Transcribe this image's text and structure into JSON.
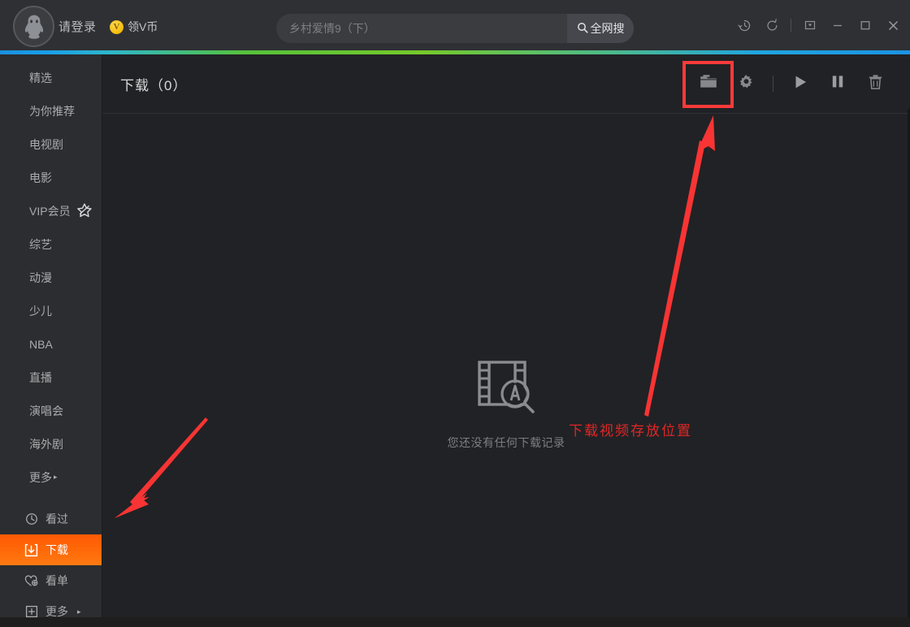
{
  "app": {
    "accent_orange": "#ff6a09",
    "annotation_red": "#e22626",
    "background": "#212225"
  },
  "header": {
    "avatar_icon": "qq-penguin-icon",
    "login_label": "请登录",
    "vcoin_badge": "V",
    "vcoin_label": "领V币",
    "search": {
      "placeholder": "乡村爱情9（下）",
      "value": "",
      "button_label": "全网搜",
      "button_icon": "search-icon"
    },
    "window_tools": [
      {
        "name": "history-icon",
        "glyph": "history"
      },
      {
        "name": "refresh-icon",
        "glyph": "refresh"
      },
      {
        "name": "divider",
        "glyph": "sep"
      },
      {
        "name": "restore-down-icon",
        "glyph": "box-arrow"
      },
      {
        "name": "minimize-icon",
        "glyph": "minimize"
      },
      {
        "name": "maximize-icon",
        "glyph": "maximize"
      },
      {
        "name": "close-icon",
        "glyph": "close"
      }
    ]
  },
  "sidebar": {
    "channels": [
      {
        "label": "精选",
        "badge": null
      },
      {
        "label": "为你推荐",
        "badge": null
      },
      {
        "label": "电视剧",
        "badge": null
      },
      {
        "label": "电影",
        "badge": null
      },
      {
        "label": "VIP会员",
        "badge": "vip-star-icon"
      },
      {
        "label": "综艺",
        "badge": null
      },
      {
        "label": "动漫",
        "badge": null
      },
      {
        "label": "少儿",
        "badge": null
      },
      {
        "label": "NBA",
        "badge": null
      },
      {
        "label": "直播",
        "badge": null
      },
      {
        "label": "演唱会",
        "badge": null
      },
      {
        "label": "海外剧",
        "badge": null
      },
      {
        "label": "更多",
        "badge": null,
        "caret": "▸"
      }
    ],
    "personal": [
      {
        "label": "看过",
        "icon": "clock-icon",
        "active": false,
        "caret": ""
      },
      {
        "label": "下载",
        "icon": "download-box-icon",
        "active": true,
        "caret": ""
      },
      {
        "label": "看单",
        "icon": "heart-plus-icon",
        "active": false,
        "caret": ""
      },
      {
        "label": "更多",
        "icon": "plus-box-icon",
        "active": false,
        "caret": "▸"
      }
    ]
  },
  "main": {
    "title": "下载（0）",
    "toolbar": [
      {
        "name": "open-folder-button",
        "icon": "folder-icon",
        "highlighted": true
      },
      {
        "name": "settings-button",
        "icon": "gear-icon",
        "highlighted": false
      },
      {
        "name": "divider",
        "icon": "sep",
        "highlighted": false
      },
      {
        "name": "start-all-button",
        "icon": "play-icon",
        "highlighted": false
      },
      {
        "name": "pause-all-button",
        "icon": "pause-icon",
        "highlighted": false
      },
      {
        "name": "delete-button",
        "icon": "trash-icon",
        "highlighted": false
      }
    ],
    "empty_state": {
      "icon": "film-search-icon",
      "text": "您还没有任何下载记录"
    }
  },
  "annotations": {
    "box_target": "open-folder-button",
    "label": "下载视频存放位置",
    "arrow_to_folder": "arrow pointing up-right at folder button",
    "arrow_to_download_nav": "arrow pointing down-left at 下载 sidebar item"
  }
}
